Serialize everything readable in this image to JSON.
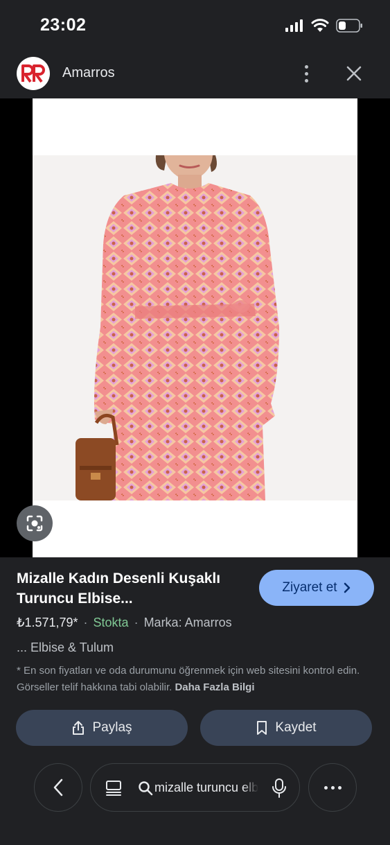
{
  "status_bar": {
    "time": "23:02"
  },
  "header": {
    "site_name": "Amarros"
  },
  "product": {
    "title": "Mizalle Kadın Desenli Kuşaklı Turuncu Elbise...",
    "visit_label": "Ziyaret et",
    "price": "₺1.571,79*",
    "stock": "Stokta",
    "brand": "Marka: Amarros",
    "category": "... Elbise & Tulum",
    "disclaimer": "* En son fiyatları ve oda durumunu öğrenmek için web sitesini kontrol edin. Görseller telif hakkına tabi olabilir.",
    "more_info_label": "Daha Fazla Bilgi"
  },
  "actions": {
    "share_label": "Paylaş",
    "save_label": "Kaydet"
  },
  "bottom_nav": {
    "search_query": "mizalle turuncu elbise"
  },
  "colors": {
    "background": "#202124",
    "visit_button": "#8ab4f8",
    "stock_green": "#81c995",
    "action_button": "#394457",
    "dress_pattern_pink": "#f29a9a",
    "logo_red": "#d9232e"
  },
  "icons": [
    "signal-icon",
    "wifi-icon",
    "battery-icon",
    "site-logo",
    "more-vert-icon",
    "close-icon",
    "lens-icon",
    "chevron-right-icon",
    "share-icon",
    "bookmark-icon",
    "back-icon",
    "tabs-icon",
    "search-icon",
    "mic-icon",
    "more-horiz-icon"
  ]
}
